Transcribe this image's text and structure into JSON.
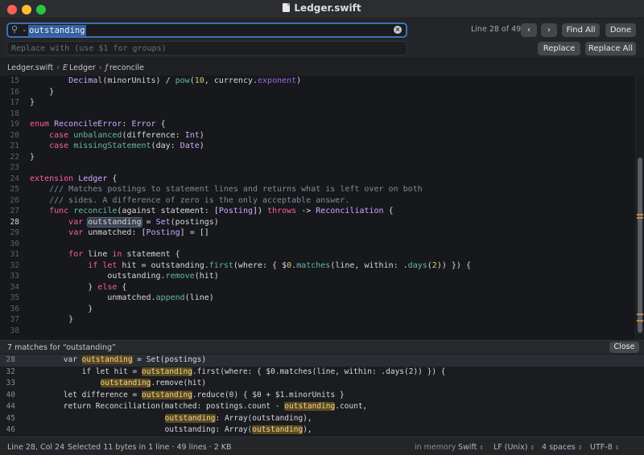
{
  "window": {
    "title": "Ledger.swift"
  },
  "find": {
    "query": "outstanding",
    "replace_placeholder": "Replace with (use $1 for groups)",
    "match_status": "Line 28 of 49",
    "prev_label": "‹",
    "next_label": "›",
    "find_all_label": "Find All",
    "done_label": "Done",
    "replace_label": "Replace",
    "replace_all_label": "Replace All"
  },
  "breadcrumb": {
    "file": "Ledger.swift",
    "type_symbol": "E",
    "type": "Ledger",
    "func_symbol": "ƒ",
    "func": "reconcile"
  },
  "editor": {
    "current_line": 28,
    "line_numbers": [
      "15",
      "16",
      "17",
      "18",
      "19",
      "20",
      "21",
      "22",
      "23",
      "24",
      "25",
      "26",
      "27",
      "28",
      "29",
      "30",
      "31",
      "32",
      "33",
      "34",
      "35",
      "36",
      "37",
      "38"
    ],
    "lines": [
      "        Decimal(minorUnits) / pow(10, currency.exponent)",
      "    }",
      "}",
      "",
      "enum ReconcileError: Error {",
      "    case unbalanced(difference: Int)",
      "    case missingStatement(day: Date)",
      "}",
      "",
      "extension Ledger {",
      "    /// Matches postings to statement lines and returns what is left over on both",
      "    /// sides. A difference of zero is the only acceptable answer.",
      "    func reconcile(against statement: [Posting]) throws -> Reconciliation {",
      "        var outstanding = Set(postings)",
      "        var unmatched: [Posting] = []",
      "",
      "        for line in statement {",
      "            if let hit = outstanding.first(where: { $0.matches(line, within: .days(2)) }) {",
      "                outstanding.remove(hit)",
      "            } else {",
      "                unmatched.append(line)",
      "            }",
      "        }",
      ""
    ]
  },
  "results": {
    "title": "7 matches for “outstanding”",
    "close_label": "Close",
    "rows": [
      {
        "line": "28",
        "pre": "        var ",
        "match": "outstanding",
        "post": " = Set(postings)"
      },
      {
        "line": "32",
        "pre": "            if let hit = ",
        "match": "outstanding",
        "post": ".first(where: { $0.matches(line, within: .days(2)) }) {"
      },
      {
        "line": "33",
        "pre": "                ",
        "match": "outstanding",
        "post": ".remove(hit)"
      },
      {
        "line": "40",
        "pre": "        let difference = ",
        "match": "outstanding",
        "post": ".reduce(0) { $0 + $1.minorUnits }"
      },
      {
        "line": "44",
        "pre": "        return Reconciliation(matched: postings.count - ",
        "match": "outstanding",
        "post": ".count,"
      },
      {
        "line": "45",
        "pre": "                              ",
        "match": "outstanding",
        "post": ": Array(outstanding),"
      },
      {
        "line": "46",
        "pre": "                              outstanding: Array(",
        "match": "outstanding",
        "post": "),"
      }
    ]
  },
  "status": {
    "position": "Line 28, Col 24",
    "selection": "Selected 11 bytes in 1 line · 49 lines · 2 KB",
    "storage": "in memory",
    "language": "Swift",
    "line_endings": "LF (Unix)",
    "indentation": "4 spaces",
    "encoding": "UTF-8"
  },
  "colors": {
    "accent": "#3d6fb8",
    "keyword": "#fc5fa3",
    "type": "#d0a8ff",
    "function": "#67b7a4",
    "number": "#d9c97c",
    "comment": "#7f8c98",
    "match_highlight": "#5b4a21",
    "scroll_marker": "#c98a3f"
  },
  "icons": [
    "search-icon",
    "chevron-down-icon",
    "clear-icon",
    "document-icon"
  ]
}
